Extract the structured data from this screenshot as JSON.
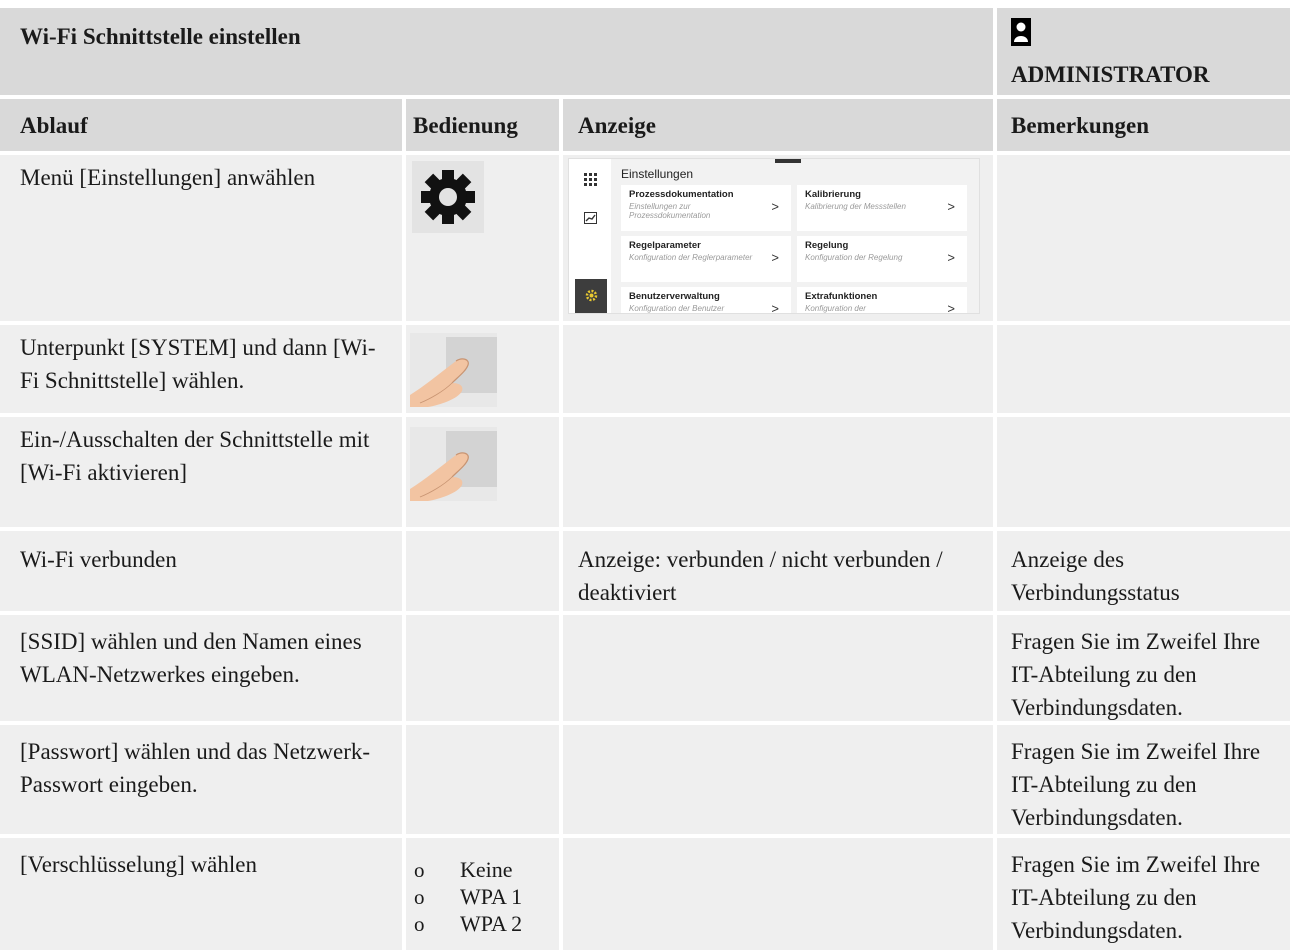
{
  "header": {
    "title": "Wi-Fi Schnittstelle einstellen",
    "role": "ADMINISTRATOR",
    "role_icon": "user-icon"
  },
  "columns": [
    "Ablauf",
    "Bedienung",
    "Anzeige",
    "Bemerkungen"
  ],
  "rows": [
    {
      "ablauf": "Menü [Einstellungen] anwählen",
      "bedienung_icon": "gear-icon",
      "anzeige": "",
      "bemerkungen": ""
    },
    {
      "ablauf": "Unterpunkt [SYSTEM] und dann [Wi-Fi Schnittstelle] wählen.",
      "bedienung_icon": "finger-tap-icon",
      "anzeige": "",
      "bemerkungen": ""
    },
    {
      "ablauf": "Ein-/Ausschalten der Schnittstelle mit [Wi-Fi aktivieren]",
      "bedienung_icon": "finger-tap-icon",
      "anzeige": "",
      "bemerkungen": ""
    },
    {
      "ablauf": "Wi-Fi verbunden",
      "anzeige": "Anzeige: verbunden / nicht verbunden / deaktiviert",
      "bemerkungen": "Anzeige des Verbindungsstatus"
    },
    {
      "ablauf": "[SSID] wählen und den Namen eines WLAN-Netzwerkes eingeben.",
      "anzeige": "",
      "bemerkungen": "Fragen Sie im Zweifel Ihre IT-Abteilung zu den Verbindungsdaten."
    },
    {
      "ablauf": "[Passwort] wählen und das Netzwerk-Passwort eingeben.",
      "anzeige": "",
      "bemerkungen": "Fragen Sie im Zweifel Ihre IT-Abteilung zu den Verbindungsdaten."
    },
    {
      "ablauf": "[Verschlüsselung] wählen",
      "bedienung_options": [
        "Keine",
        "WPA 1",
        "WPA 2"
      ],
      "bullet": "o",
      "anzeige": "",
      "bemerkungen": "Fragen Sie im Zweifel Ihre IT-Abteilung zu den Verbindungsdaten."
    }
  ],
  "screenshot": {
    "title": "Einstellungen",
    "rail_icons": [
      "apps-grid-icon",
      "chart-icon",
      "settings-icon"
    ],
    "cards": [
      {
        "title": "Prozessdokumentation",
        "subtitle": "Einstellungen zur Prozessdokumentation",
        "chevron": ">"
      },
      {
        "title": "Kalibrierung",
        "subtitle": "Kalibrierung der Messstellen",
        "chevron": ">"
      },
      {
        "title": "Regelparameter",
        "subtitle": "Konfiguration der Reglerparameter",
        "chevron": ">"
      },
      {
        "title": "Regelung",
        "subtitle": "Konfiguration der Regelung",
        "chevron": ">"
      },
      {
        "title": "Benutzerverwaltung",
        "subtitle": "Konfiguration der Benutzer",
        "chevron": ">"
      },
      {
        "title": "Extrafunktionen",
        "subtitle": "Konfiguration der",
        "chevron": ">"
      }
    ]
  }
}
